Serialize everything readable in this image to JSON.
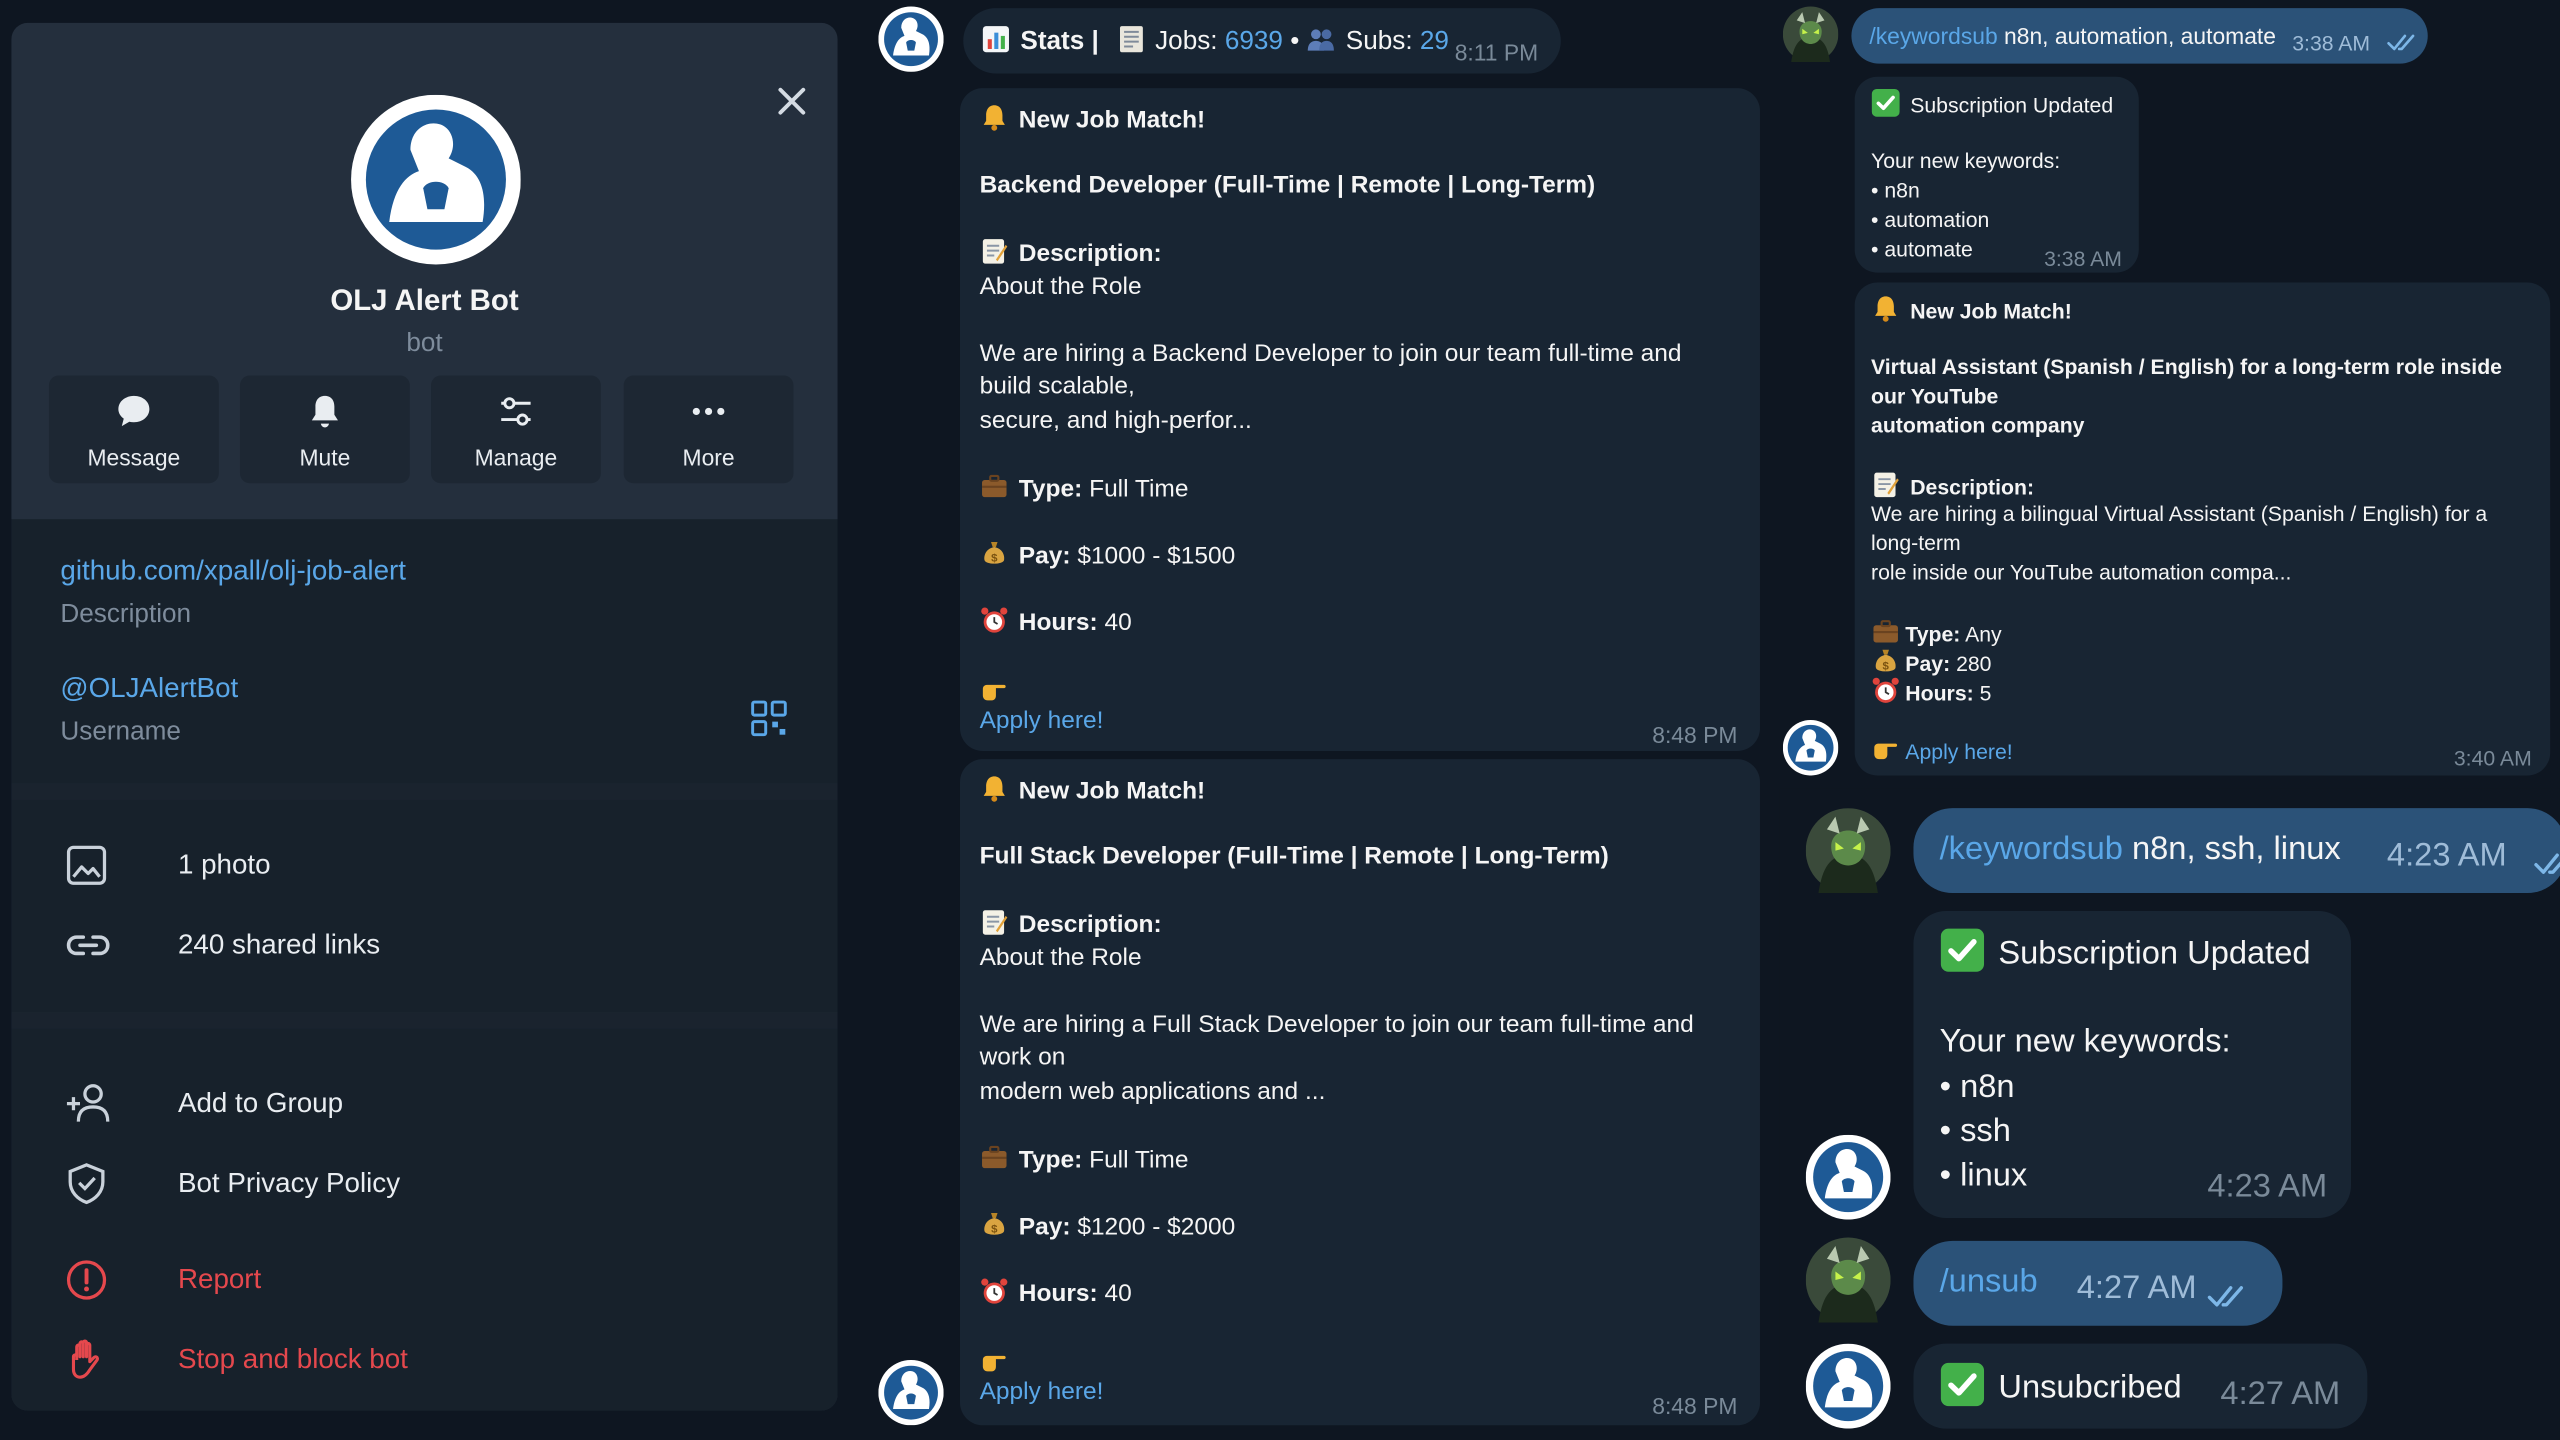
{
  "profile": {
    "name": "OLJ Alert Bot",
    "subtitle": "bot",
    "actions": [
      "Message",
      "Mute",
      "Manage",
      "More"
    ],
    "link": "github.com/xpall/olj-job-alert",
    "link_caption": "Description",
    "username": "@OLJAlertBot",
    "username_caption": "Username",
    "photos": "1 photo",
    "shared_links": "240 shared links",
    "add_to_group": "Add to Group",
    "privacy": "Bot Privacy Policy",
    "report": "Report",
    "stop_block": "Stop and block bot"
  },
  "colors": {
    "accent": "#5aa7e8",
    "danger": "#e5484d",
    "panel": "#242f3d",
    "bubble_in": "#182533",
    "bubble_out": "#2b5278",
    "bg": "#0e1621"
  },
  "middle": {
    "stats": {
      "label": "Stats |",
      "jobs_label": "Jobs:",
      "jobs": "6939",
      "subs_label": "Subs:",
      "subs": "29",
      "time": "8:11 PM"
    },
    "jobs": [
      {
        "header": "New Job Match!",
        "title": "Backend Developer (Full-Time | Remote | Long-Term)",
        "desc_label": "Description:",
        "about": "About the Role",
        "desc": [
          "We are hiring a Backend Developer to join our team full-time and",
          "build scalable,",
          "secure, and high-perfor..."
        ],
        "type_label": "Type:",
        "type": "Full Time",
        "pay_label": "Pay:",
        "pay": "$1000 - $1500",
        "hours_label": "Hours:",
        "hours": "40",
        "apply": "Apply here!",
        "time": "8:48 PM"
      },
      {
        "header": "New Job Match!",
        "title": "Full Stack Developer (Full-Time | Remote | Long-Term)",
        "desc_label": "Description:",
        "about": "About the Role",
        "desc": [
          "We are hiring a Full Stack Developer to join our team full-time and",
          "work on",
          "modern web applications and ..."
        ],
        "type_label": "Type:",
        "type": "Full Time",
        "pay_label": "Pay:",
        "pay": "$1200 - $2000",
        "hours_label": "Hours:",
        "hours": "40",
        "apply": "Apply here!",
        "time": "8:48 PM"
      }
    ]
  },
  "right": {
    "cmd1": {
      "cmd": "/keywordsub",
      "args": " n8n, automation, automate",
      "time": "3:38 AM"
    },
    "sub1": {
      "title": "Subscription Updated",
      "label": "Your new keywords:",
      "items": [
        "• n8n",
        "• automation",
        "• automate"
      ],
      "time": "3:38 AM"
    },
    "job": {
      "header": "New Job Match!",
      "title": [
        "Virtual Assistant (Spanish / English) for a long-term role inside",
        "our YouTube",
        "automation company"
      ],
      "desc_label": "Description:",
      "desc": [
        "We are hiring a bilingual Virtual Assistant (Spanish / English) for a",
        "long-term",
        "role inside our YouTube automation compa..."
      ],
      "type_label": "Type:",
      "type": "Any",
      "pay_label": "Pay:",
      "pay": "280",
      "hours_label": "Hours:",
      "hours": "5",
      "apply": "Apply here!",
      "time": "3:40 AM"
    },
    "cmd2": {
      "cmd": "/keywordsub",
      "args": " n8n, ssh, linux",
      "time": "4:23 AM"
    },
    "sub2": {
      "title": "Subscription Updated",
      "label": "Your new keywords:",
      "items": [
        "• n8n",
        "• ssh",
        "• linux"
      ],
      "time": "4:23 AM"
    },
    "cmd3": {
      "cmd": "/unsub",
      "time": "4:27 AM"
    },
    "unsub": {
      "title": "Unsubcribed",
      "time": "4:27 AM"
    }
  }
}
